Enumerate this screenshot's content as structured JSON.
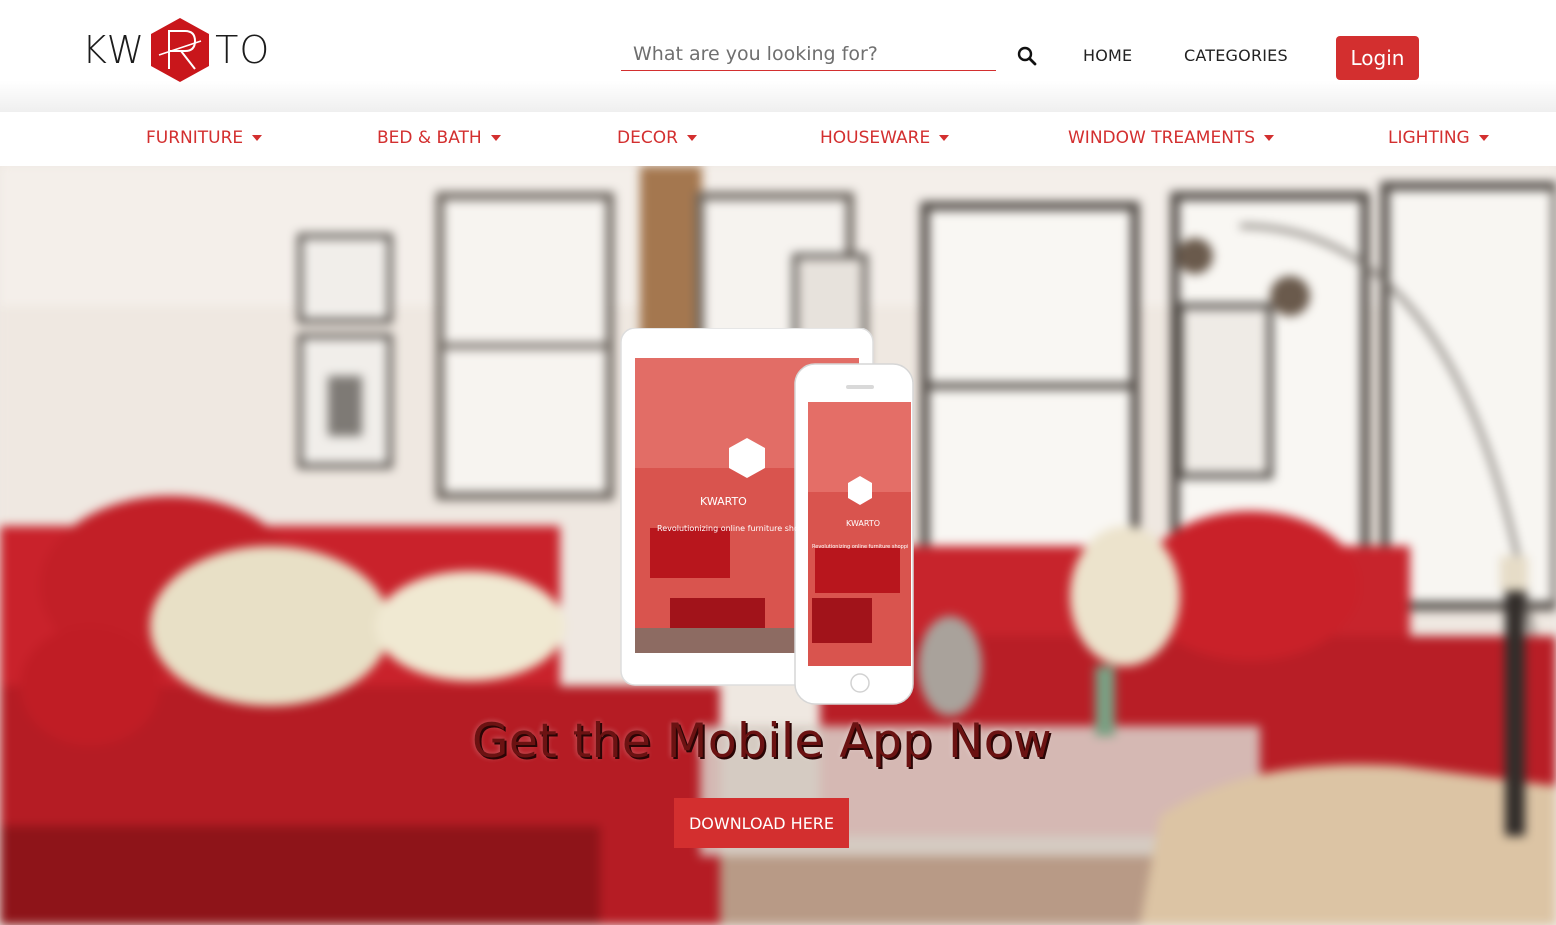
{
  "brand": {
    "logo_left": "KW",
    "logo_right": "TO",
    "logo_mark": "R"
  },
  "search": {
    "placeholder": "What are you looking for?",
    "icon": "search-icon"
  },
  "top_nav": {
    "home": "HOME",
    "categories": "CATEGORIES",
    "login": "Login"
  },
  "category_nav": {
    "items": [
      {
        "label": "FURNITURE",
        "icon": "caret-down-icon"
      },
      {
        "label": "BED & BATH",
        "icon": "caret-down-icon"
      },
      {
        "label": "DECOR",
        "icon": "caret-down-icon"
      },
      {
        "label": "HOUSEWARE",
        "icon": "caret-down-icon"
      },
      {
        "label": "WINDOW TREAMENTS",
        "icon": "caret-down-icon"
      },
      {
        "label": "LIGHTING",
        "icon": "caret-down-icon"
      }
    ]
  },
  "hero": {
    "title": "Get the Mobile App Now",
    "button": "DOWNLOAD HERE",
    "screen_brand": "KWARTO",
    "screen_tagline": "Revolutionizing online furniture shopping"
  },
  "colors": {
    "accent": "#d32f2f",
    "title_text": "#6b1212"
  }
}
